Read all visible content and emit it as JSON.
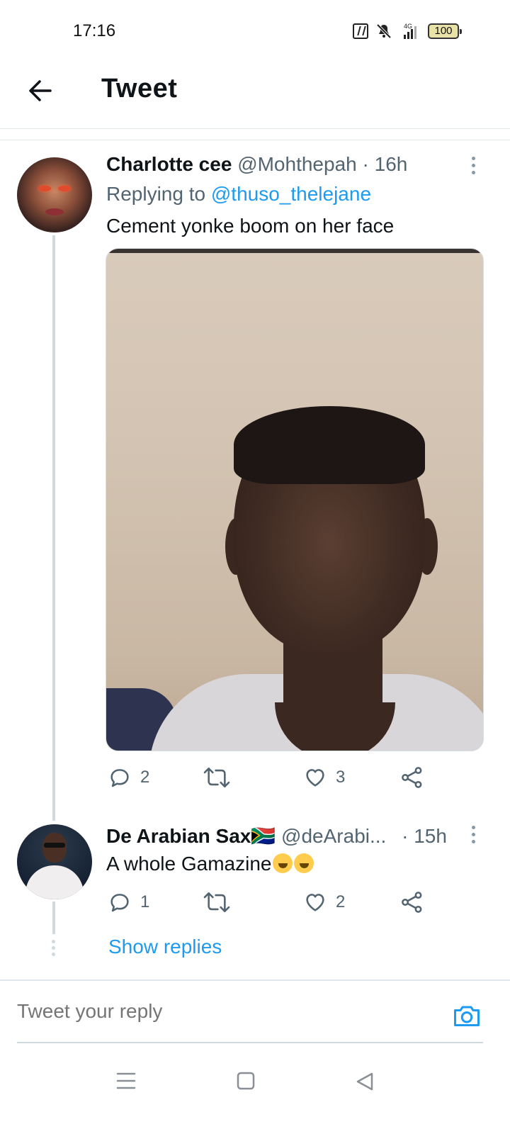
{
  "status_bar": {
    "time": "17:16",
    "network": "4G",
    "battery": "100",
    "icons": [
      "nfc-icon",
      "mute-icon",
      "signal-icon",
      "battery-icon"
    ]
  },
  "header": {
    "title": "Tweet",
    "back_icon": "arrow-left-icon"
  },
  "tweets": [
    {
      "name": "Charlotte cee",
      "handle": "@Mohthepah",
      "time": "· 16h",
      "replying_prefix": "Replying to",
      "replying_to": "@thuso_thelejane",
      "text": "Cement yonke boom on her face",
      "has_photo": true,
      "replies": "2",
      "retweets": "",
      "likes": "3"
    },
    {
      "name": "De Arabian Sax",
      "flag": "🇿🇦",
      "handle": "@deArabi...",
      "time": "· 15h",
      "text": "A whole Gamazine",
      "emoji": "🤣🤣",
      "replies": "1",
      "retweets": "",
      "likes": "2"
    }
  ],
  "show_replies": "Show replies",
  "reply_bar": {
    "placeholder": "Tweet your reply",
    "camera_icon": "camera-icon"
  },
  "nav_bar": {
    "icons": [
      "menu-icon",
      "home-square-icon",
      "back-triangle-icon"
    ]
  },
  "colors": {
    "accent": "#1d9bf0",
    "muted": "#536471",
    "text": "#0f1419",
    "divider": "#e1e8ed"
  }
}
